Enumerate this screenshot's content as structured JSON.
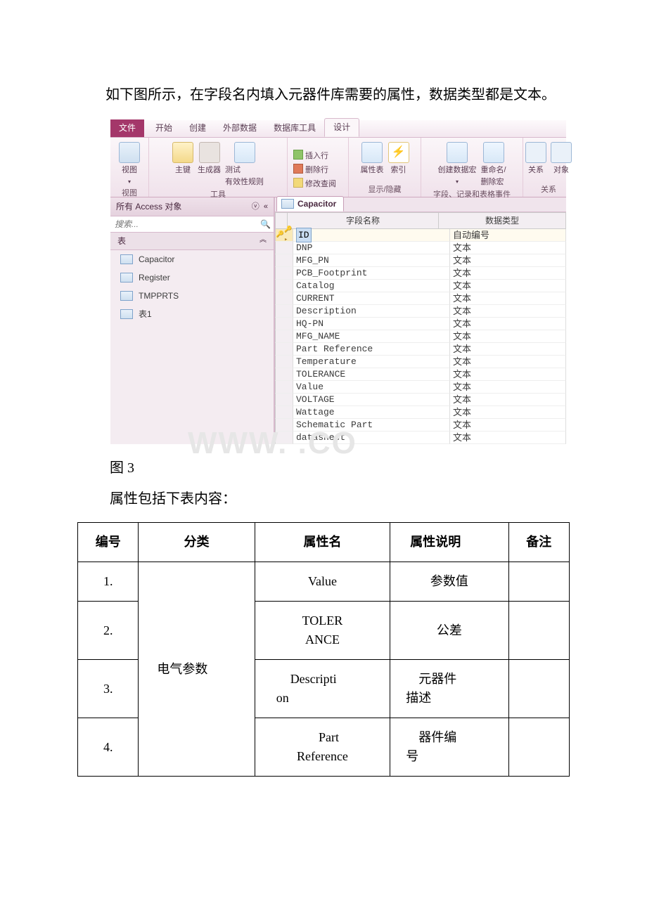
{
  "intro_text": "如下图所示，在字段名内填入元器件库需要的属性，数据类型都是文本。",
  "ribbon": {
    "tabs": {
      "file": "文件",
      "home": "开始",
      "create": "创建",
      "external": "外部数据",
      "dbtools": "数据库工具",
      "design": "设计"
    },
    "groups": {
      "view": "视图",
      "tools": "工具",
      "showhide": "显示/隐藏",
      "events": "字段、记录和表格事件",
      "rel": "关系"
    },
    "btn": {
      "view": "视图",
      "pk": "主键",
      "builder": "生成器",
      "test": "测试\n有效性规则",
      "ins": "插入行",
      "del": "删除行",
      "lookup": "修改查阅",
      "propsheet": "属性表",
      "index": "索引",
      "macroCreate": "创建数据宏",
      "rename": "重命名/\n删除宏",
      "relation": "关系",
      "depend": "对象"
    }
  },
  "nav": {
    "title": "所有 Access 对象",
    "search_placeholder": "搜索...",
    "section": "表",
    "items": [
      "Capacitor",
      "Register",
      "TMPPRTS",
      "表1"
    ]
  },
  "designer": {
    "tab_label": "Capacitor",
    "col_field": "字段名称",
    "col_type": "数据类型",
    "auto_number": "自动编号",
    "text": "文本",
    "fields": [
      "ID",
      "DNP",
      "MFG_PN",
      "PCB_Footprint",
      "Catalog",
      "CURRENT",
      "Description",
      "HQ-PN",
      "MFG_NAME",
      "Part Reference",
      "Temperature",
      "TOLERANCE",
      "Value",
      "VOLTAGE",
      "Wattage",
      "Schematic Part",
      "datasheet"
    ]
  },
  "caption": "图 3",
  "prop_intro": "属性包括下表内容：",
  "watermark": "WWW.          .CO",
  "prop_table": {
    "headers": {
      "no": "编号",
      "cat": "分类",
      "name": "属性名",
      "desc": "属性说明",
      "note": "备注"
    },
    "cat_elec": "电气参数",
    "rows": [
      {
        "no": "1.",
        "name": "Value",
        "desc": "参数值"
      },
      {
        "no": "2.",
        "name": "TOLERANCE",
        "name_wrap": [
          "TOLER",
          "ANCE"
        ],
        "desc": "公差"
      },
      {
        "no": "3.",
        "name": "Description",
        "name_wrap": [
          "Descripti",
          "on"
        ],
        "desc": "元器件描述",
        "desc_wrap": [
          "元器件",
          "描述"
        ]
      },
      {
        "no": "4.",
        "name": "Part Reference",
        "name_wrap": [
          "Part",
          "Reference"
        ],
        "desc": "器件编号",
        "desc_wrap": [
          "器件编",
          "号"
        ]
      }
    ]
  }
}
